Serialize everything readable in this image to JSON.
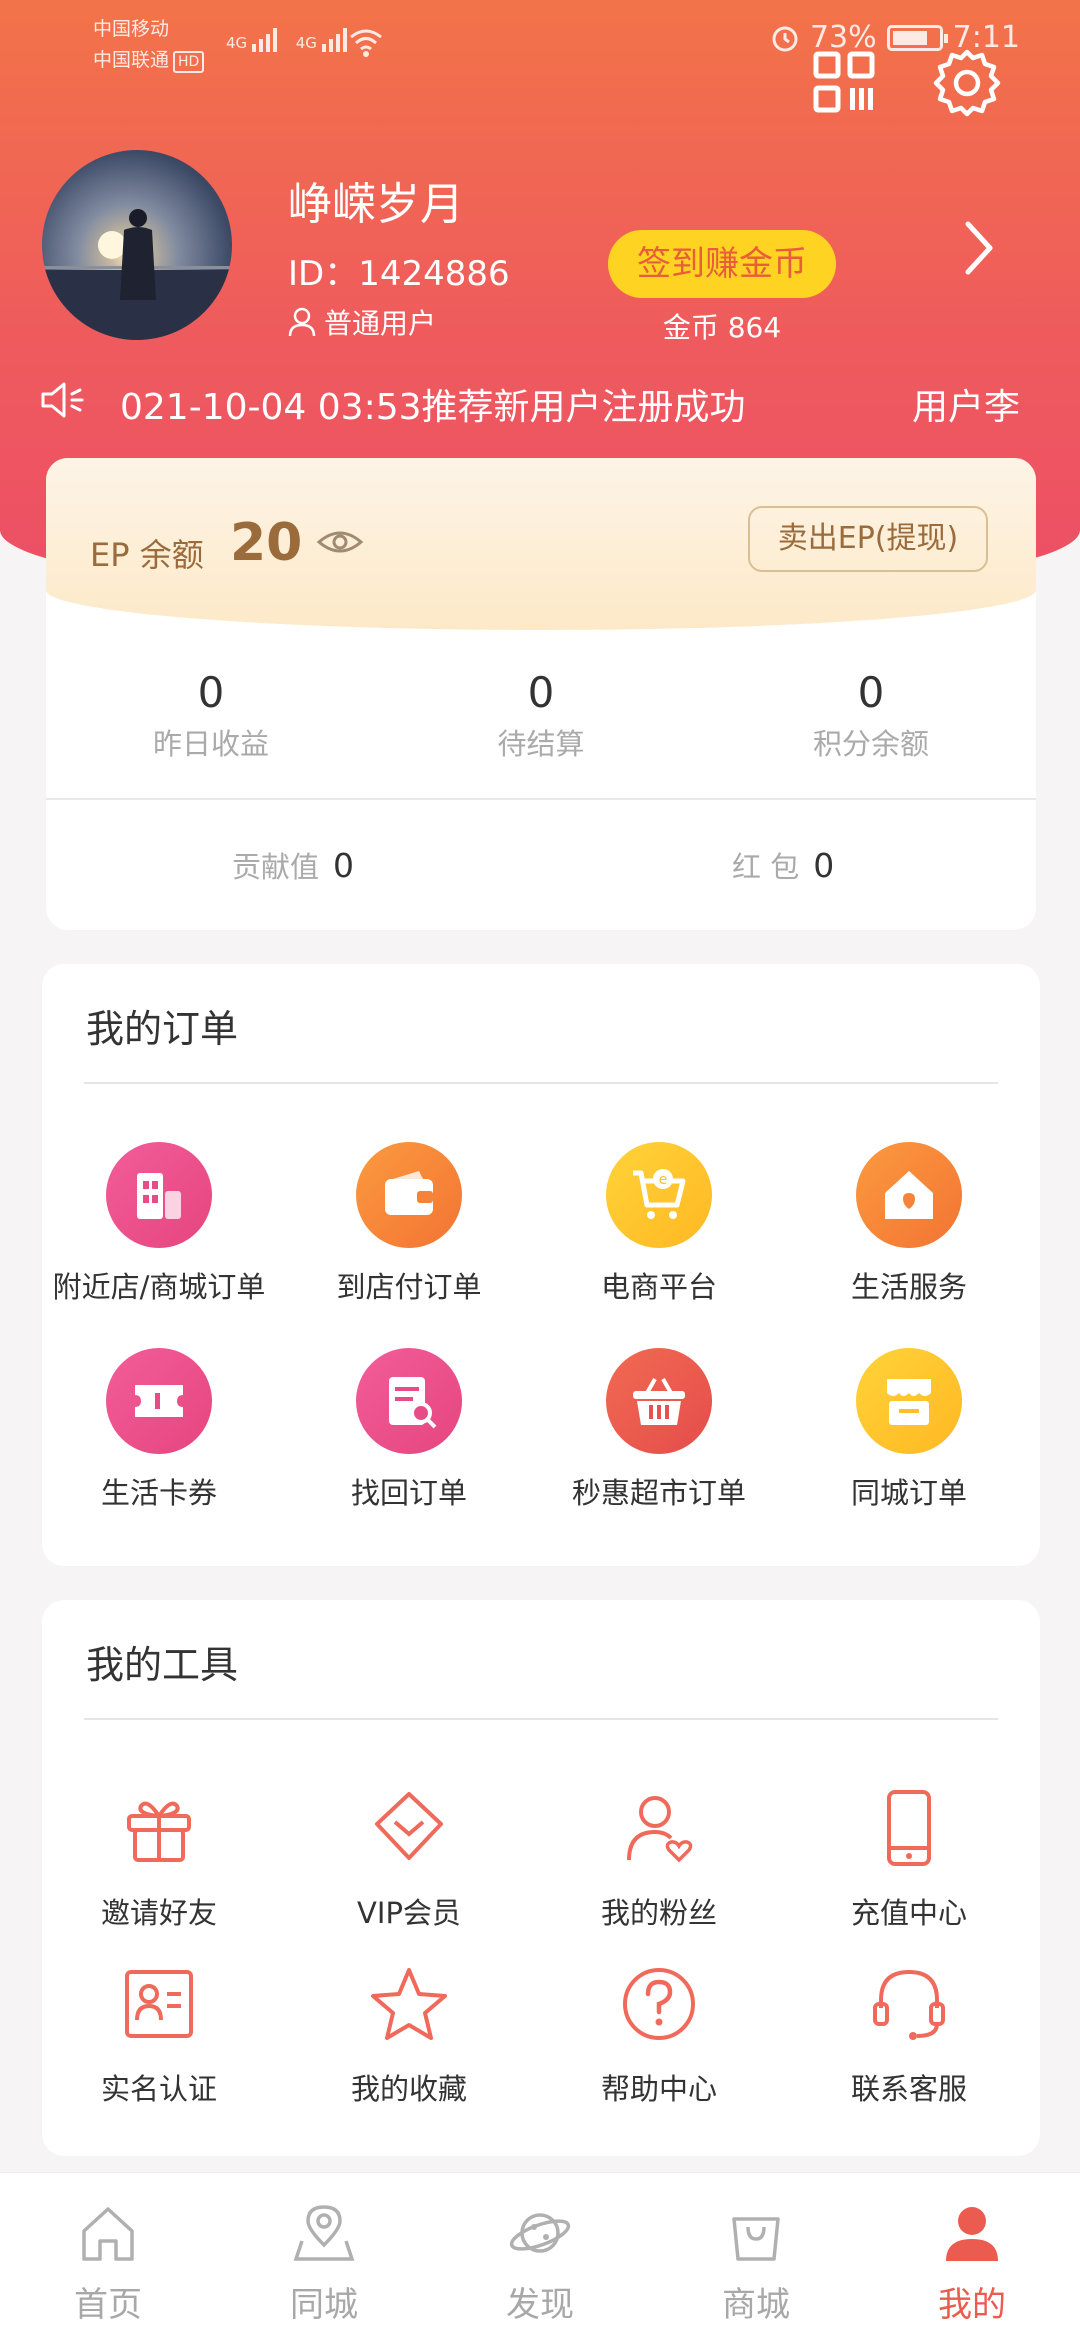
{
  "status_bar": {
    "carrier1": "中国移动",
    "carrier2": "中国联通",
    "hd": "HD",
    "net1": "4G",
    "net2": "4G",
    "battery": "73%",
    "time": "7:11"
  },
  "profile": {
    "name": "峥嵘岁月",
    "id": "ID：1424886",
    "level": "普通用户",
    "signin_label": "签到赚金币",
    "coins": "金币 864"
  },
  "notice": {
    "message1": "021-10-04 03:53推荐新用户注册成功",
    "message2": "用户李"
  },
  "wallet": {
    "ep_label": "EP 余额",
    "ep_value": "20",
    "sell_label": "卖出EP(提现)",
    "stats": [
      {
        "value": "0",
        "label": "昨日收益"
      },
      {
        "value": "0",
        "label": "待结算"
      },
      {
        "value": "0",
        "label": "积分余额"
      }
    ],
    "contribution_label": "贡献值",
    "contribution_value": "0",
    "redpacket_label": "红 包",
    "redpacket_value": "0"
  },
  "orders": {
    "title": "我的订单",
    "items": [
      {
        "label": "附近店/商城订单",
        "icon": "store-icon"
      },
      {
        "label": "到店付订单",
        "icon": "wallet-icon"
      },
      {
        "label": "电商平台",
        "icon": "cart-icon"
      },
      {
        "label": "生活服务",
        "icon": "house-icon"
      },
      {
        "label": "生活卡券",
        "icon": "ticket-icon"
      },
      {
        "label": "找回订单",
        "icon": "document-search-icon"
      },
      {
        "label": "秒惠超市订单",
        "icon": "basket-icon"
      },
      {
        "label": "同城订单",
        "icon": "shop-icon"
      }
    ]
  },
  "tools": {
    "title": "我的工具",
    "items": [
      {
        "label": "邀请好友",
        "icon": "gift-icon"
      },
      {
        "label": "VIP会员",
        "icon": "vip-diamond-icon"
      },
      {
        "label": "我的粉丝",
        "icon": "fans-icon"
      },
      {
        "label": "充值中心",
        "icon": "phone-icon"
      },
      {
        "label": "实名认证",
        "icon": "id-card-icon"
      },
      {
        "label": "我的收藏",
        "icon": "star-icon"
      },
      {
        "label": "帮助中心",
        "icon": "help-icon"
      },
      {
        "label": "联系客服",
        "icon": "headset-icon"
      }
    ]
  },
  "tabs": [
    {
      "label": "首页",
      "icon": "home-icon"
    },
    {
      "label": "同城",
      "icon": "location-icon"
    },
    {
      "label": "发现",
      "icon": "planet-icon"
    },
    {
      "label": "商城",
      "icon": "shopping-bag-icon"
    },
    {
      "label": "我的",
      "icon": "user-icon",
      "active": true
    }
  ],
  "colors": {
    "header_top": "#f27349",
    "header_bottom": "#ec4e66",
    "accent": "#ec5b4f",
    "signin_bg": "#ffd321",
    "ep_text": "#9b6b3c"
  }
}
